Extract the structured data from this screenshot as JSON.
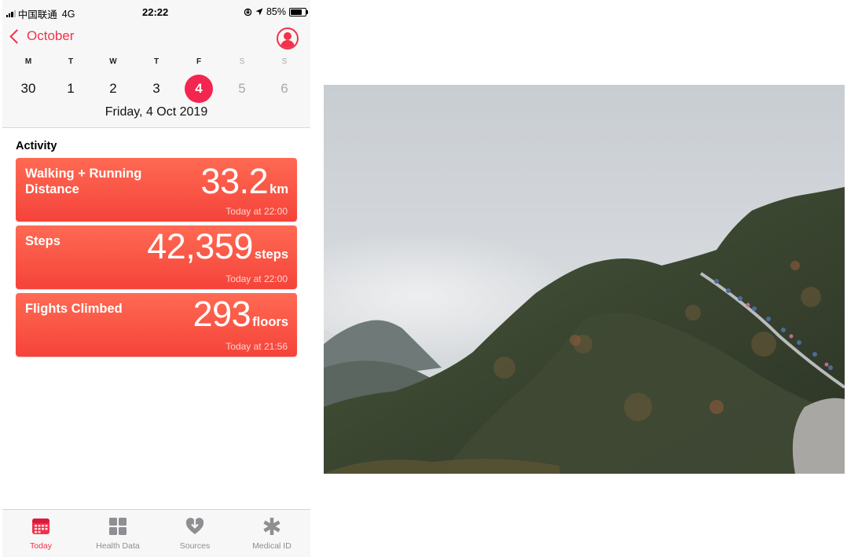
{
  "status_bar": {
    "carrier": "中国联通",
    "network": "4G",
    "time": "22:22",
    "battery": "85%",
    "battery_level": 0.85
  },
  "nav": {
    "back_label": "October"
  },
  "week": {
    "days": [
      {
        "letter": "M",
        "num": "30",
        "weekend": false,
        "selected": false
      },
      {
        "letter": "T",
        "num": "1",
        "weekend": false,
        "selected": false
      },
      {
        "letter": "W",
        "num": "2",
        "weekend": false,
        "selected": false
      },
      {
        "letter": "T",
        "num": "3",
        "weekend": false,
        "selected": false
      },
      {
        "letter": "F",
        "num": "4",
        "weekend": false,
        "selected": true
      },
      {
        "letter": "S",
        "num": "5",
        "weekend": true,
        "selected": false
      },
      {
        "letter": "S",
        "num": "6",
        "weekend": true,
        "selected": false
      }
    ],
    "selected_date": "Friday, 4 Oct 2019"
  },
  "activity": {
    "heading": "Activity",
    "cards": [
      {
        "title": "Walking + Running Distance",
        "value": "33.2",
        "unit": "km",
        "time": "Today at 22:00"
      },
      {
        "title": "Steps",
        "value": "42,359",
        "unit": "steps",
        "time": "Today at 22:00"
      },
      {
        "title": "Flights Climbed",
        "value": "293",
        "unit": "floors",
        "time": "Today at 21:56"
      }
    ]
  },
  "tabs": [
    {
      "label": "Today",
      "icon": "calendar-icon",
      "active": true
    },
    {
      "label": "Health Data",
      "icon": "grid-icon",
      "active": false
    },
    {
      "label": "Sources",
      "icon": "heart-arrow-icon",
      "active": false
    },
    {
      "label": "Medical ID",
      "icon": "asterisk-icon",
      "active": false
    }
  ],
  "colors": {
    "accent": "#f2324b",
    "card": "#f5533f",
    "inactive": "#8e8e93"
  }
}
